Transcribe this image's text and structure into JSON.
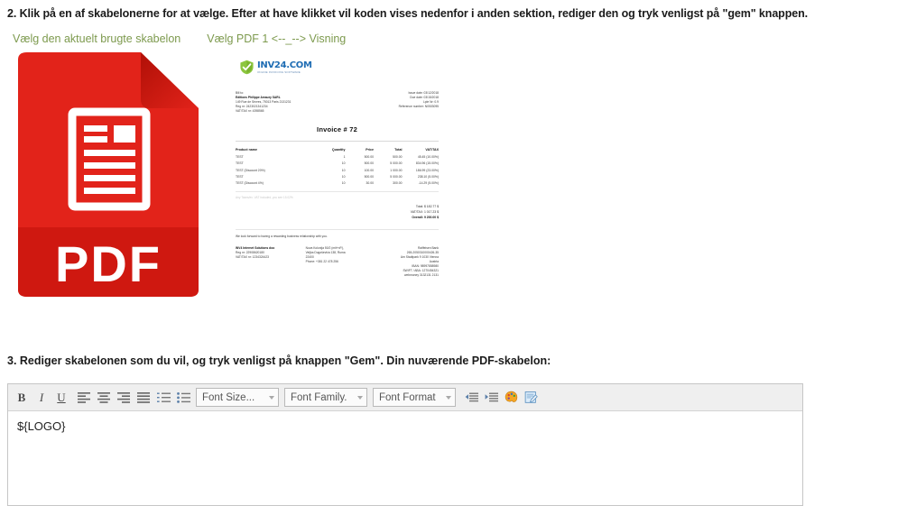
{
  "page": {
    "step2_instruction": "2. Klik på en af skabelonerne for at vælge. Efter at have klikket vil koden vises nedenfor i anden sektion, rediger den og tryk venligst på \"gem\" knappen.",
    "step3_instruction": "3. Rediger skabelonen som du vil, og tryk venligst på knappen \"Gem\". Din nuværende PDF-skabelon:"
  },
  "links": {
    "current_template": "Vælg den aktuelt brugte skabelon",
    "pdf_template_1": "Vælg PDF 1 <--_--> Visning",
    "color": "#7d9a4e"
  },
  "templates": {
    "pdf_icon": {
      "label": "PDF",
      "icon": "pdf-file-icon",
      "color": "#e2231a",
      "color_dark": "#c21910"
    },
    "invoice_preview": {
      "logo": {
        "name": "INV24.COM",
        "tagline": "ONLINE INVOICING SOFTWARE",
        "mark": "shield-check-icon"
      },
      "bill_to_label": "Bill to:",
      "bill_to": [
        "Editions Philippe Amaury SARL",
        "149 Rue de Sèvres, 75013 Paris 2131231",
        "Reg nr: 2423021341234",
        "VAT/TAX nr: 4398565"
      ],
      "meta": [
        "Issue date: 03/12/2018",
        "Due date: 03/15/2018",
        "Lple Nr: 0.9",
        "Reference number: N0503095"
      ],
      "title": "Invoice # 72",
      "table": {
        "headers": [
          "Product name",
          "Quantity",
          "Price",
          "Total",
          "VAT/TAX"
        ],
        "rows": [
          [
            "TEST",
            "1",
            "500.00",
            "500.00",
            "45.45 (10.00%)"
          ],
          [
            "TEST",
            "10",
            "500.00",
            "5 000.00",
            "834.96 (15.00%)"
          ],
          [
            "TEST (Discount 20%)",
            "10",
            "100.00",
            "1 000.00",
            "186.99 (23.00%)"
          ],
          [
            "TEST",
            "10",
            "500.00",
            "5 000.00",
            "238.10 (5.00%)"
          ],
          [
            "TEST (Discount 4%)",
            "10",
            "30.00",
            "300.00",
            "-14.29 (5.00%)"
          ]
        ]
      },
      "note": "Any Taxes/ex. VAT included, you see 15.02%",
      "totals": [
        {
          "label": "Total: $ 182.77 $",
          "strong": false
        },
        {
          "label": "VAT/TAX: 1 017.23 $",
          "strong": false
        },
        {
          "label": "Overall: 9 200.00 $",
          "strong": true
        }
      ],
      "thanks": "We look forward to having a rewarding business relationship with you.",
      "footer": {
        "left": [
          "INV4 Internet Solutions doo",
          "Reg nr: 22908620180",
          "VAT/TAX nr: 1234324423"
        ],
        "middle": [
          "Nova Kolonija 50/2 (mit+nP.),",
          "Veljka Dugoševića 138, Ruma",
          "22400",
          "Phone: +381 22 478 256"
        ],
        "right": [
          "Raiffeisen Bank",
          "265-2050310000426-35",
          "Am Stadtpark 9 1030 Vienna",
          "Austria",
          "IBAN: 98997858980",
          "SWIFT / ABA: 1270454321",
          "webmoney 3132131 2131"
        ]
      }
    }
  },
  "editor": {
    "toolbar": {
      "bold": {
        "label": "B",
        "name": "bold-button"
      },
      "italic": {
        "label": "I",
        "name": "italic-button"
      },
      "underline": {
        "label": "U",
        "name": "underline-button"
      },
      "align_left": "align-left-icon",
      "align_center": "align-center-icon",
      "align_right": "align-right-icon",
      "align_justify": "align-justify-icon",
      "ordered_list": "ordered-list-icon",
      "unordered_list": "unordered-list-icon",
      "font_size": "Font Size...",
      "font_family": "Font Family.",
      "font_format": "Font Format",
      "outdent": "outdent-icon",
      "indent": "indent-icon",
      "text_color": "text-color-palette-icon",
      "source": "edit-source-icon"
    },
    "content": "${LOGO}"
  }
}
